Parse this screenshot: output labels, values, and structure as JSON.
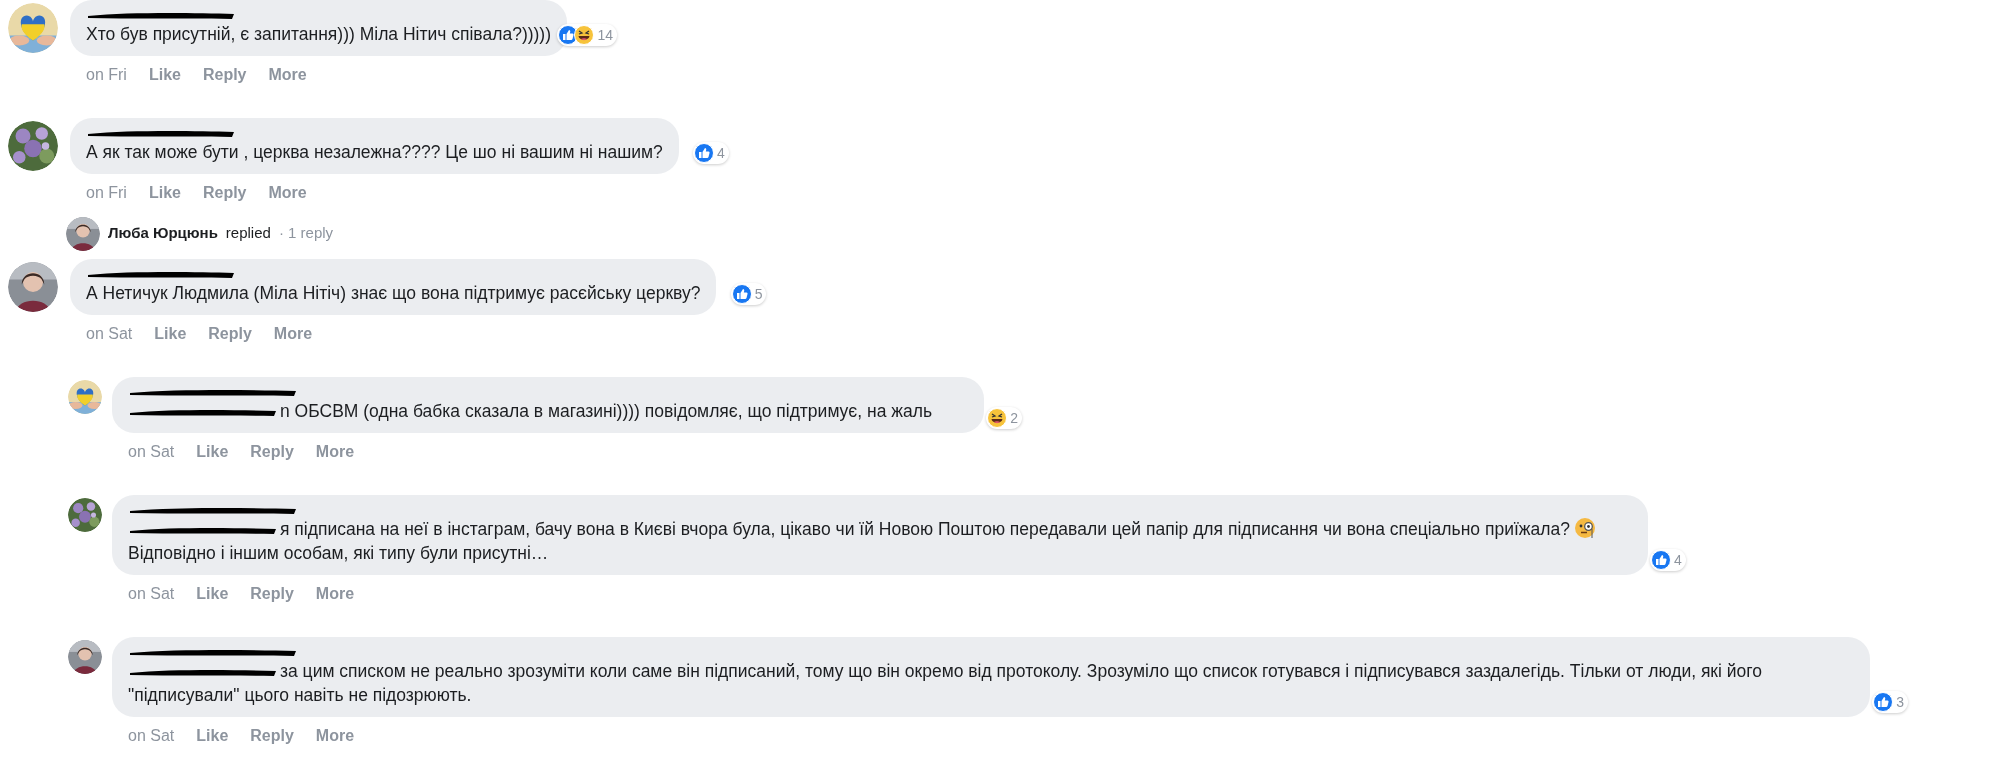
{
  "comments": [
    {
      "avatar": {
        "kind": "heart"
      },
      "name_redacted": true,
      "tag_redacted": false,
      "text": "Хто був присутній, є запитання))) Міла Нітич співала?)))))",
      "reactions": [
        {
          "kind": "like"
        },
        {
          "kind": "haha"
        }
      ],
      "reaction_count": "14",
      "time": "on Fri",
      "actions": [
        "Like",
        "Reply",
        "More"
      ]
    },
    {
      "avatar": {
        "kind": "flowers"
      },
      "name_redacted": true,
      "tag_redacted": false,
      "text": "А як так може бути , церква незалежна???? Це шо ні вашим ні нашим?",
      "reactions": [
        {
          "kind": "like"
        }
      ],
      "reaction_count": "4",
      "time": "on Fri",
      "actions": [
        "Like",
        "Reply",
        "More"
      ],
      "replies_summary": {
        "avatar": {
          "kind": "person"
        },
        "name": "Люба Юрцюнь",
        "verb": "replied",
        "count": "· 1 reply"
      }
    },
    {
      "avatar": {
        "kind": "person"
      },
      "name_redacted": true,
      "tag_redacted": false,
      "text": "А Нетичук Людмила (Міла Нітіч) знає що вона підтримує расєйську церкву?",
      "reactions": [
        {
          "kind": "like"
        }
      ],
      "reaction_count": "5",
      "time": "on Sat",
      "actions": [
        "Like",
        "Reply",
        "More"
      ],
      "children": [
        {
          "avatar": {
            "kind": "heart"
          },
          "name_redacted": true,
          "tag_redacted": true,
          "text": "n ОБСВМ (одна бабка сказала в магазині)))) повідомляє, що підтримує, на жаль",
          "reactions": [
            {
              "kind": "haha"
            }
          ],
          "reaction_count": "2",
          "time": "on Sat",
          "actions": [
            "Like",
            "Reply",
            "More"
          ]
        },
        {
          "avatar": {
            "kind": "flowers"
          },
          "name_redacted": true,
          "tag_redacted": true,
          "text": "я підписана на неї в інстаграм, бачу вона в Києві вчора була, цікаво чи їй Новою Поштою передавали цей папір для підписання чи вона спеціально приїжала?",
          "emoji": {
            "kind": "monocle"
          },
          "text_2": "Відповідно і іншим особам, які типу були присутні…",
          "reactions": [
            {
              "kind": "like"
            }
          ],
          "reaction_count": "4",
          "time": "on Sat",
          "actions": [
            "Like",
            "Reply",
            "More"
          ]
        },
        {
          "avatar": {
            "kind": "person"
          },
          "name_redacted": true,
          "tag_redacted": true,
          "text": "за цим списком не реально зрозуміти коли саме він підписаний, тому що він окремо від протоколу. Зрозуміло що список готувався і підписувався заздалегідь. Тільки от люди, які його \"підписували\" цього навіть не підозрюють.",
          "reactions": [
            {
              "kind": "like"
            }
          ],
          "reaction_count": "3",
          "time": "on Sat",
          "actions": [
            "Like",
            "Reply",
            "More"
          ]
        }
      ]
    }
  ]
}
